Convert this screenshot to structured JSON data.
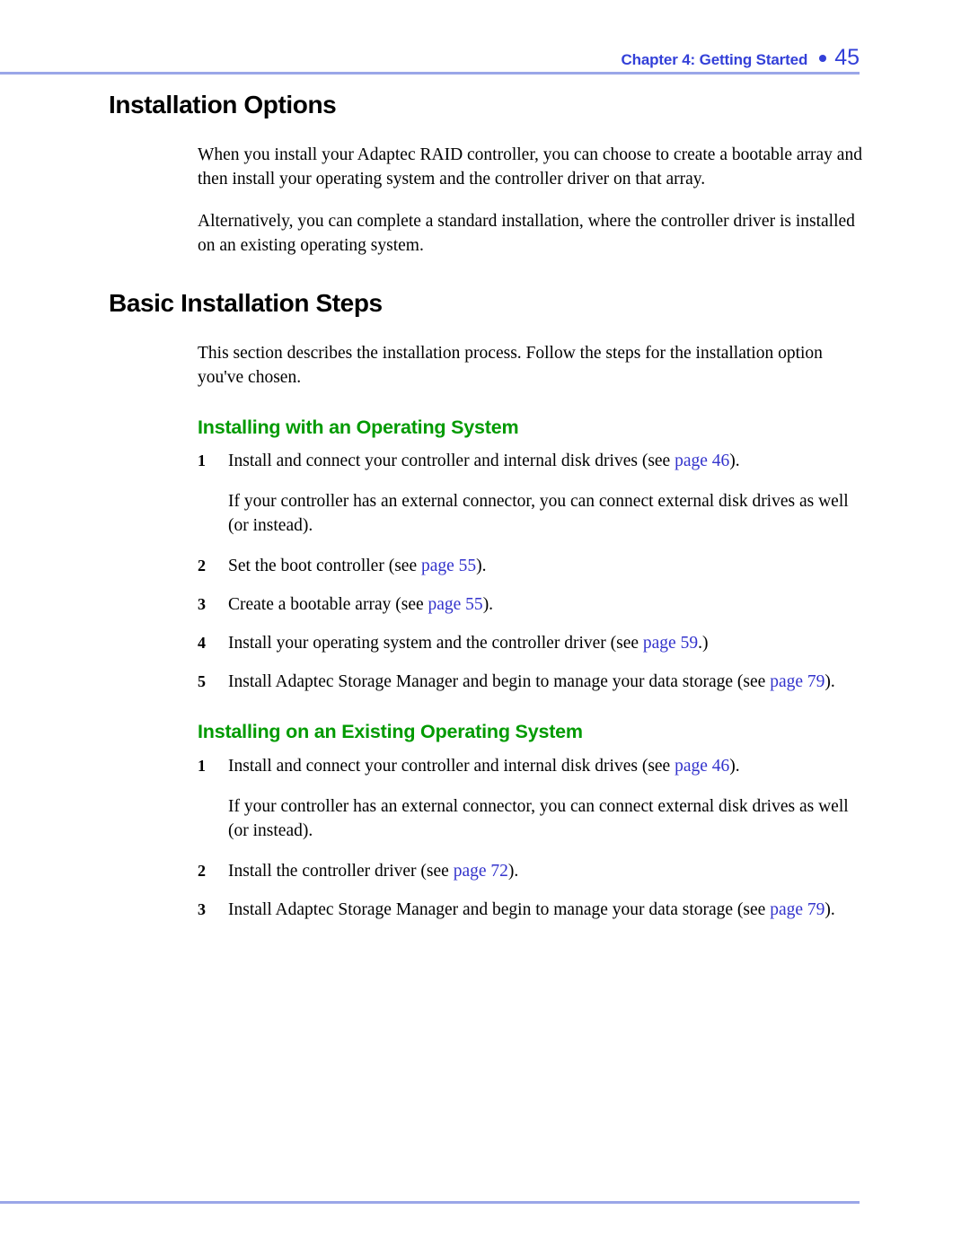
{
  "header": {
    "chapter": "Chapter 4: Getting Started",
    "page_number": "45",
    "bullet": "round-bullet",
    "text_color": "#3340d8",
    "rule_color": "#9aa6e8"
  },
  "colors": {
    "heading_black": "#000000",
    "subheading_green": "#009a00",
    "crossref_blue": "#3333cc"
  },
  "sections": {
    "installation_options": {
      "title": "Installation Options",
      "paragraphs": [
        "When you install your Adaptec RAID controller, you can choose to create a bootable array and then install your operating system and the controller driver on that array.",
        "Alternatively, you can complete a standard installation, where the controller driver is installed on an existing operating system."
      ]
    },
    "basic_installation_steps": {
      "title": "Basic Installation Steps",
      "intro": "This section describes the installation process. Follow the steps for the installation option you've chosen.",
      "subsections": [
        {
          "title": "Installing with an Operating System",
          "steps": [
            {
              "number": "1",
              "text_before": "Install and connect your controller and internal disk drives (see ",
              "link": "page 46",
              "text_after": ").",
              "continuation": "If your controller has an external connector, you can connect external disk drives as well (or instead)."
            },
            {
              "number": "2",
              "text_before": "Set the boot controller (see ",
              "link": "page 55",
              "text_after": ")."
            },
            {
              "number": "3",
              "text_before": "Create a bootable array (see ",
              "link": "page 55",
              "text_after": ")."
            },
            {
              "number": "4",
              "text_before": "Install your operating system and the controller driver (see ",
              "link": "page 59",
              "text_after": ".)"
            },
            {
              "number": "5",
              "text_before": "Install Adaptec Storage Manager and begin to manage your data storage (see ",
              "link": "page 79",
              "text_after": ")."
            }
          ]
        },
        {
          "title": "Installing on an Existing Operating System",
          "steps": [
            {
              "number": "1",
              "text_before": "Install and connect your controller and internal disk drives (see ",
              "link": "page 46",
              "text_after": ").",
              "continuation": "If your controller has an external connector, you can connect external disk drives as well (or instead)."
            },
            {
              "number": "2",
              "text_before": "Install the controller driver (see ",
              "link": "page 72",
              "text_after": ")."
            },
            {
              "number": "3",
              "text_before": "Install Adaptec Storage Manager and begin to manage your data storage (see ",
              "link": "page 79",
              "text_after": ")."
            }
          ]
        }
      ]
    }
  }
}
